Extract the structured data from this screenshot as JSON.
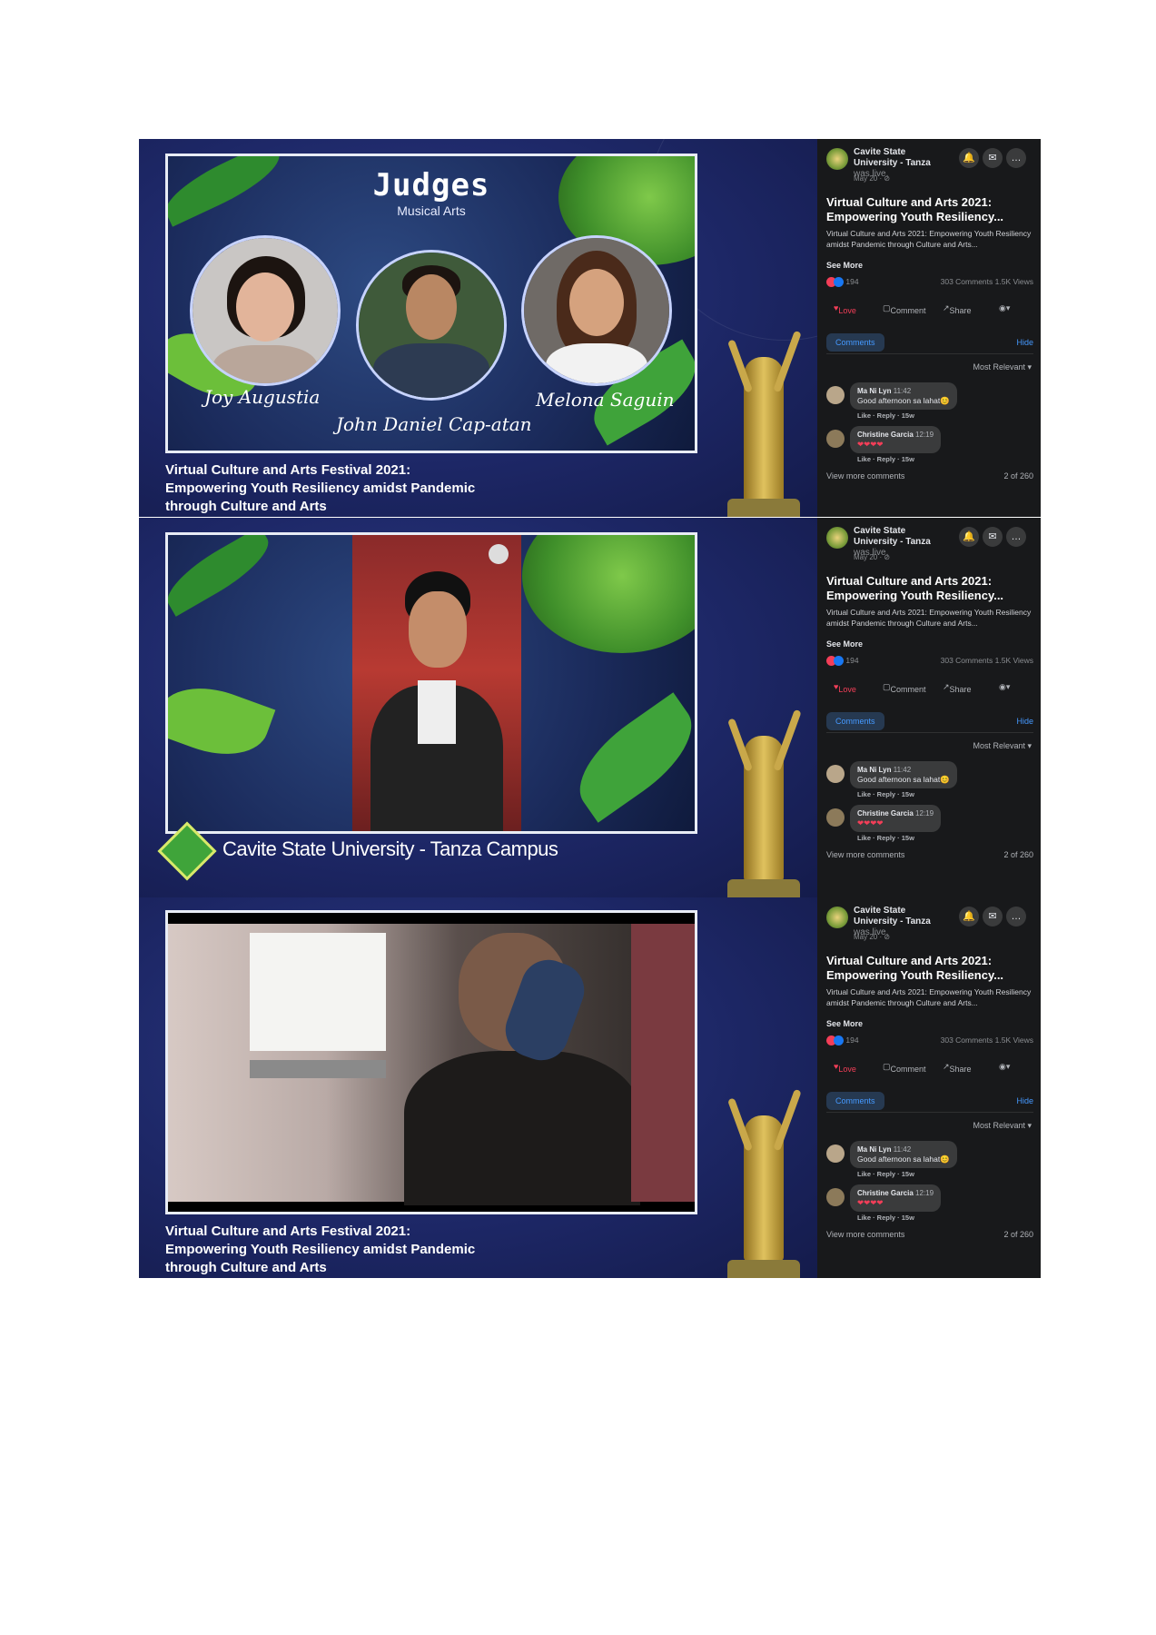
{
  "panels": [
    {
      "judges_title": "Judges",
      "judges_subtitle": "Musical Arts",
      "judges": [
        {
          "name": "Joy Augustia"
        },
        {
          "name": "John Daniel Cap-atan"
        },
        {
          "name": "Melona Saguin"
        }
      ],
      "caption_lines": [
        "Virtual Culture and Arts Festival 2021:",
        "Empowering Youth Resiliency amidst Pandemic",
        "through Culture and Arts"
      ]
    },
    {
      "logo_text": "Cavite State University - Tanza Campus"
    },
    {
      "caption_lines": [
        "Virtual Culture and Arts Festival 2021:",
        "Empowering Youth Resiliency amidst Pandemic",
        "through Culture and Arts"
      ]
    }
  ],
  "fb_post": {
    "page_name": "Cavite State University - Tanza",
    "was_live": "was live.",
    "date": "May 20 · ⊘",
    "title": "Virtual Culture and Arts 2021: Empowering Youth Resiliency...",
    "description": "Virtual Culture and Arts 2021: Empowering Youth Resiliency amidst Pandemic through Culture and Arts...",
    "see_more": "See More",
    "reaction_count": "194",
    "comments_views": "303 Comments 1.5K Views",
    "actions": {
      "love": "Love",
      "comment": "Comment",
      "share": "Share"
    },
    "comments_tab": "Comments",
    "hide": "Hide",
    "sort": "Most Relevant ▾",
    "comments": [
      {
        "author": "Ma Ni Lyn",
        "time": "11:42",
        "text": "Good afternoon sa lahat😊",
        "links": "Like · Reply · 15w"
      },
      {
        "author": "Christine Garcia",
        "time": "12:19",
        "text": "❤❤❤❤",
        "links": "Like · Reply · 15w"
      }
    ],
    "view_more": "View more comments",
    "count": "2 of 260"
  },
  "colors": {
    "stream_bg": "#1d2766",
    "fb_bg": "#18191b",
    "fb_link": "#4599ff",
    "love": "#f33e58"
  }
}
